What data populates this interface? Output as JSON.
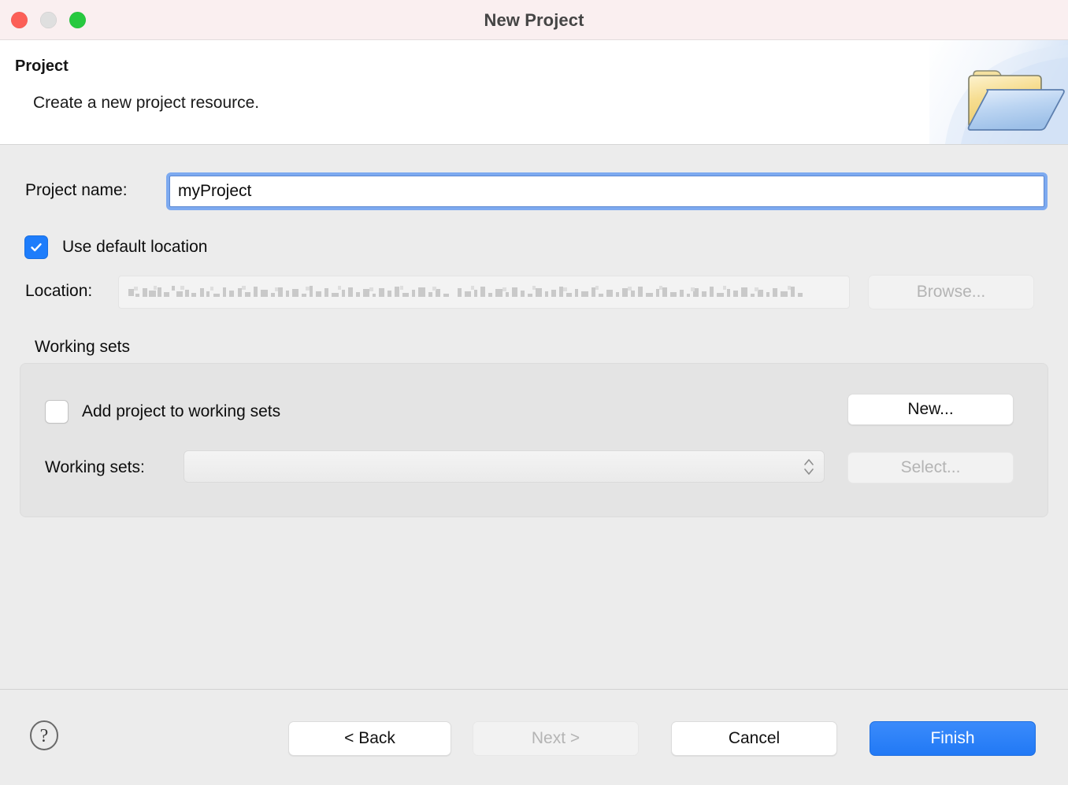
{
  "window": {
    "title": "New Project",
    "traffic_lights": [
      "close",
      "minimize",
      "zoom"
    ]
  },
  "header": {
    "title": "Project",
    "description": "Create a new project resource.",
    "banner_icon": "open-folder-icon"
  },
  "form": {
    "project_name": {
      "label": "Project name:",
      "value": "myProject",
      "placeholder": "",
      "focused": true
    },
    "use_default_location": {
      "label": "Use default location",
      "checked": true
    },
    "location": {
      "label": "Location:",
      "value": "",
      "redacted": true,
      "enabled": false
    },
    "browse_button": {
      "label": "Browse...",
      "enabled": false
    }
  },
  "working_sets": {
    "caption": "Working sets",
    "add_project_checkbox": {
      "label": "Add project to working sets",
      "checked": false
    },
    "new_button": {
      "label": "New...",
      "enabled": true
    },
    "sets_label": "Working sets:",
    "sets_combo": {
      "value": "",
      "options": [],
      "enabled": false
    },
    "select_button": {
      "label": "Select...",
      "enabled": false
    }
  },
  "footer": {
    "help_icon": "question-mark-icon",
    "back_button": {
      "label": "< Back",
      "enabled": true
    },
    "next_button": {
      "label": "Next >",
      "enabled": false
    },
    "cancel_button": {
      "label": "Cancel",
      "enabled": true
    },
    "finish_button": {
      "label": "Finish",
      "enabled": true,
      "primary": true
    }
  },
  "colors": {
    "titlebar_bg": "#faeff0",
    "dialog_bg": "#ececec",
    "header_bg": "#ffffff",
    "accent_blue": "#1e7dfb",
    "finish_blue": "#2179f5",
    "focus_ring": "#7daaf0",
    "group_bg": "#e4e4e4",
    "disabled_text": "#b4b4b4"
  }
}
